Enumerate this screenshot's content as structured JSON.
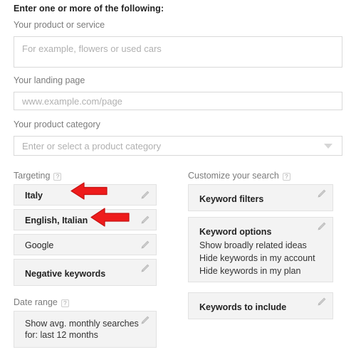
{
  "form": {
    "heading": "Enter one or more of the following:",
    "fields": [
      {
        "label": "Your product or service",
        "placeholder": "For example, flowers or used cars",
        "value": "",
        "type": "textarea"
      },
      {
        "label": "Your landing page",
        "placeholder": "www.example.com/page",
        "value": "",
        "type": "text"
      },
      {
        "label": "Your product category",
        "placeholder": "Enter or select a product category",
        "value": "",
        "type": "select"
      }
    ]
  },
  "targeting": {
    "title": "Targeting",
    "help": "?",
    "cards": [
      {
        "title": "Italy",
        "bold": true,
        "edit": "edit-icon"
      },
      {
        "title": "English, Italian",
        "bold": true,
        "edit": "edit-icon"
      },
      {
        "title": "Google",
        "bold": false,
        "edit": "edit-icon"
      },
      {
        "title": "Negative keywords",
        "bold": true,
        "edit": "edit-icon"
      }
    ]
  },
  "date_range": {
    "title": "Date range",
    "help": "?",
    "card": {
      "line1": "Show avg. monthly searches",
      "line2": "for: last 12 months",
      "edit": "edit-icon"
    }
  },
  "customize": {
    "title": "Customize your search",
    "help": "?",
    "keyword_filters": {
      "title": "Keyword filters",
      "edit": "edit-icon"
    },
    "keyword_options": {
      "title": "Keyword options",
      "options": [
        "Show broadly related ideas",
        "Hide keywords in my account",
        "Hide keywords in my plan"
      ],
      "edit": "edit-icon"
    },
    "keywords_to_include": {
      "title": "Keywords to include",
      "edit": "edit-icon"
    }
  },
  "annotations": {
    "arrows": [
      {
        "name": "red-arrow-pointing-to-italy",
        "color": "#EE1C1C"
      },
      {
        "name": "red-arrow-pointing-to-languages",
        "color": "#EE1C1C"
      }
    ]
  },
  "colors": {
    "arrow_red": "#EE1C1C",
    "card_bg": "#f3f3f3",
    "card_border": "#e2e2e2",
    "label_gray": "#7b7b7b"
  }
}
